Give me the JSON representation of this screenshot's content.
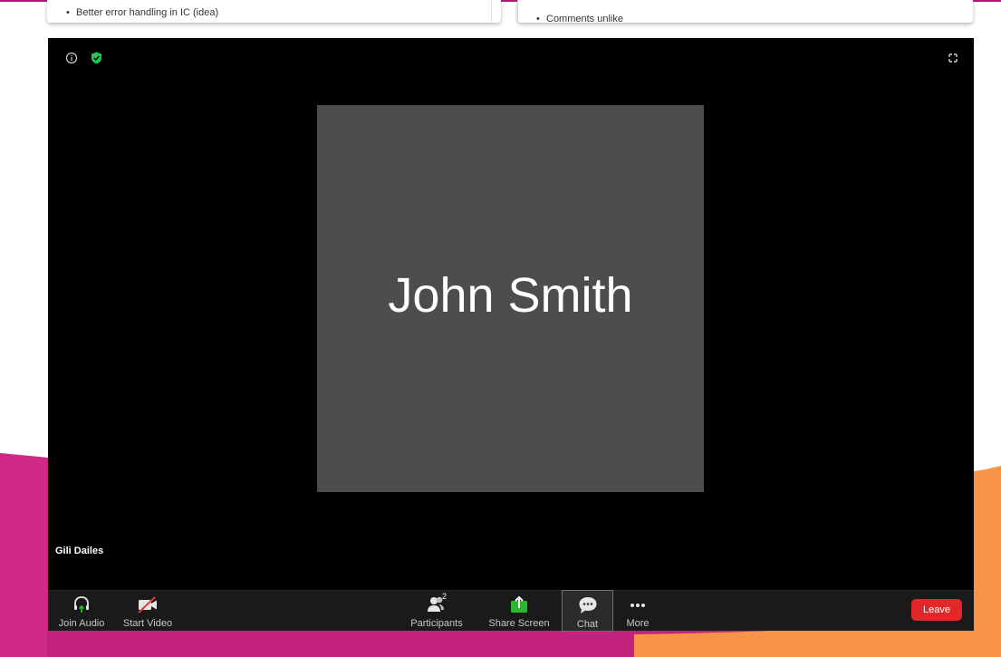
{
  "background": {
    "colors": {
      "magenta": "#c4227f",
      "orange": "#f7944a",
      "accent_line": "#b0197c"
    }
  },
  "notes": {
    "left_card_item": "Better error handling in IC (idea)",
    "right_card_item": "Comments unlike"
  },
  "meeting": {
    "top_icons": [
      "info-icon",
      "shield-check-icon",
      "fullscreen-icon"
    ],
    "participant_tile_name": "John Smith",
    "self_name": "Gili Dailes",
    "toolbar": {
      "join_audio": "Join Audio",
      "start_video": "Start Video",
      "participants": "Participants",
      "participants_count": "2",
      "share_screen": "Share Screen",
      "chat": "Chat",
      "more": "More",
      "leave": "Leave"
    },
    "colors": {
      "share_green": "#2db52d",
      "leave_red": "#e02828",
      "muted_red": "#e23a3a"
    }
  }
}
